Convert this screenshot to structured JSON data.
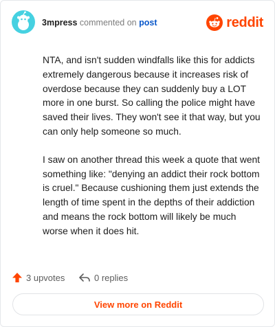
{
  "header": {
    "username": "3mpress",
    "action": "commented on",
    "post_link": "post",
    "brand_name": "reddit",
    "brand_color": "#ff4500",
    "avatar_color": "#46d1e1",
    "icons": [
      "avatar-snoo-icon",
      "reddit-logo-icon"
    ]
  },
  "comment": {
    "paragraphs": [
      "NTA, and isn't sudden windfalls like this for addicts extremely dangerous because it increases risk of overdose because they can suddenly buy a LOT more in one burst. So calling the police might have saved their lives. They won't see it that way, but you can only help someone so much.",
      "I saw on another thread this week a quote that went something like: \"denying an addict their rock bottom is cruel.\" Because cushioning them just extends the length of time spent in the depths of their addiction and means the rock bottom will likely be much worse when it does hit."
    ]
  },
  "footer": {
    "upvotes": "3 upvotes",
    "replies": "0 replies",
    "icons": [
      "upvote-arrow-icon",
      "reply-arrow-icon"
    ]
  },
  "cta": {
    "label": "View more on Reddit"
  }
}
